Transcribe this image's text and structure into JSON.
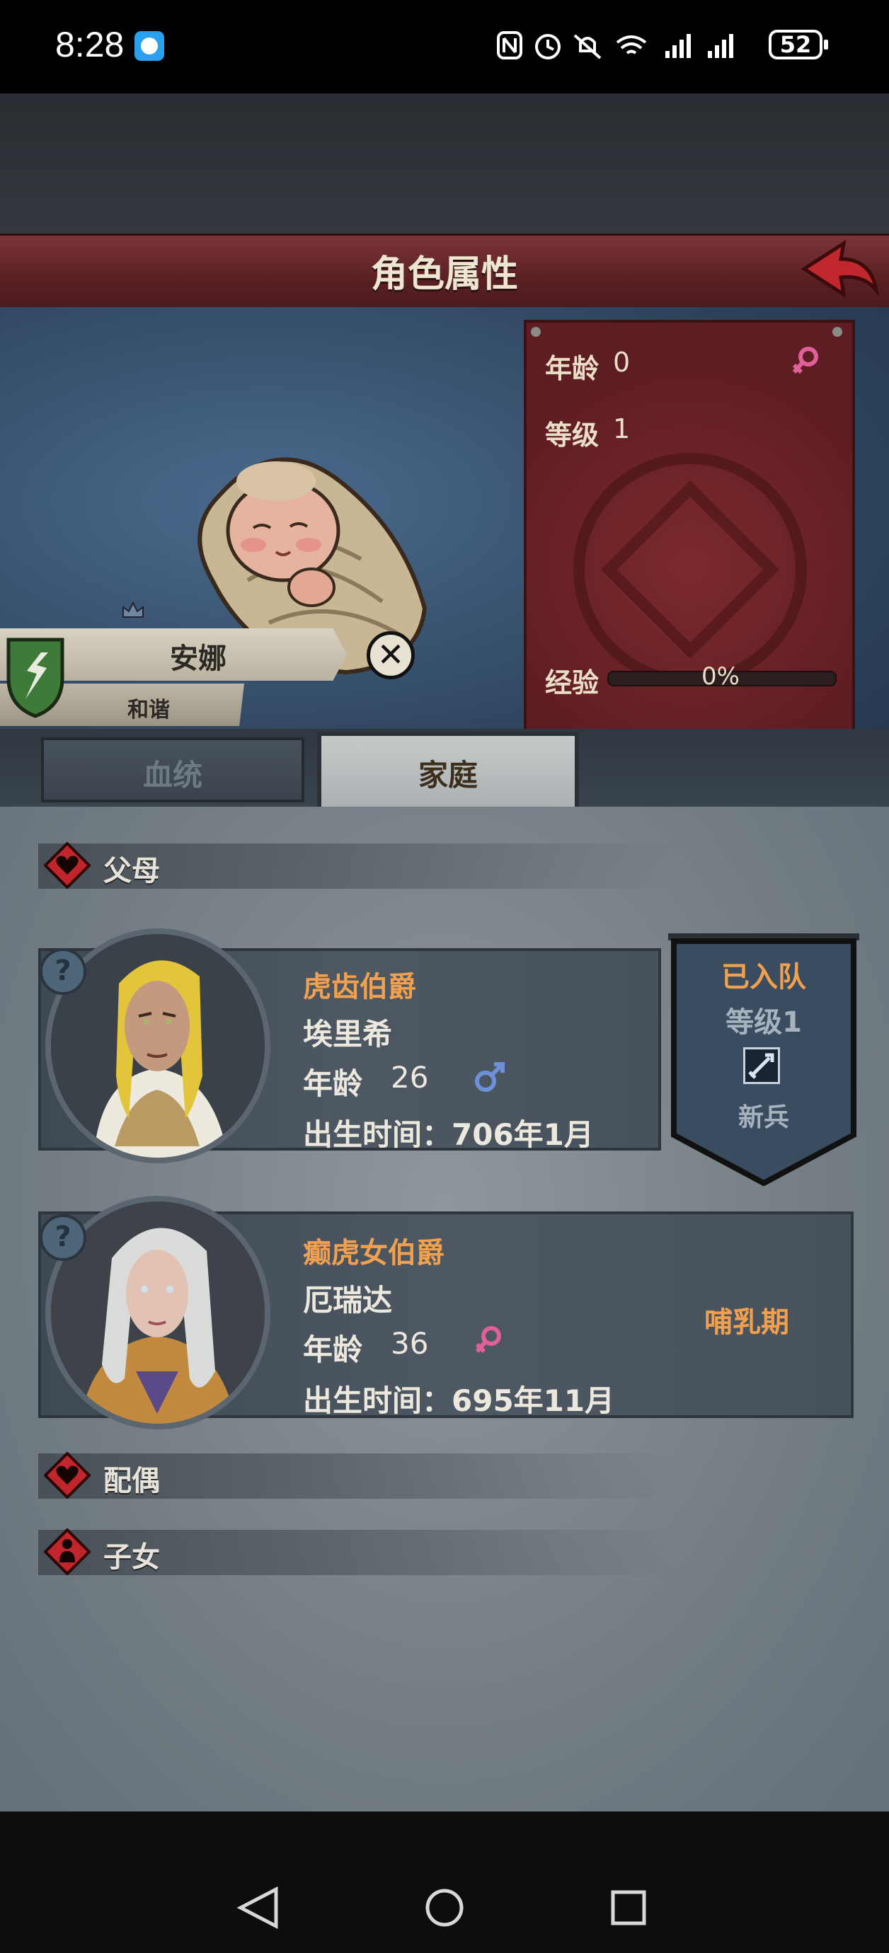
{
  "status_bar": {
    "time": "8:28",
    "battery": "52",
    "icons": [
      "nfc-icon",
      "alarm-icon",
      "mute-icon",
      "wifi-icon",
      "signal-icon",
      "signal-icon",
      "battery-icon"
    ]
  },
  "header": {
    "title": "角色属性",
    "back_icon": "back-arrow-icon"
  },
  "character": {
    "name": "安娜",
    "trait": "和谐",
    "age_label": "年龄",
    "age": "0",
    "level_label": "等级",
    "level": "1",
    "exp_label": "经验",
    "exp_percent": "0%",
    "exp_fraction": 0,
    "gender_icon": "female-icon"
  },
  "tabs": [
    {
      "label": "血统",
      "active": false
    },
    {
      "label": "家庭",
      "active": true
    }
  ],
  "sections": {
    "parents": "父母",
    "spouse": "配偶",
    "children": "子女"
  },
  "parents": [
    {
      "title": "虎齿伯爵",
      "name": "埃里希",
      "age_label": "年龄",
      "age": "26",
      "gender_icon": "male-icon",
      "birth": "出生时间：706年1月",
      "help": "?"
    },
    {
      "title": "癫虎女伯爵",
      "name": "厄瑞达",
      "age_label": "年龄",
      "age": "36",
      "gender_icon": "female-icon",
      "birth": "出生时间：695年11月",
      "help": "?"
    }
  ],
  "recruit": {
    "status": "已入队",
    "level": "等级1",
    "rank": "新兵"
  },
  "mother_status": "哺乳期",
  "colors": {
    "accent_orange": "#f0a04e",
    "banner_red": "#5e1d22",
    "female_pink": "#e0609a",
    "male_blue": "#6f90d8"
  }
}
